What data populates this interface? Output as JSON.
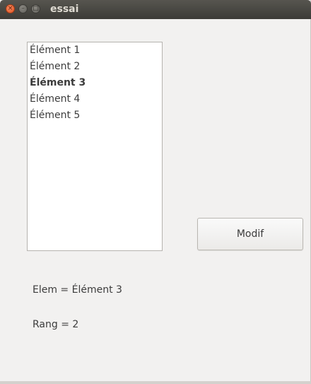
{
  "window": {
    "title": "essai",
    "close_glyph": "×",
    "min_glyph": "–",
    "max_glyph": "□"
  },
  "list": {
    "selected_index": 2,
    "items": [
      {
        "label": "Élément 1"
      },
      {
        "label": "Élément 2"
      },
      {
        "label": "Élément 3"
      },
      {
        "label": "Élément 4"
      },
      {
        "label": "Élément 5"
      }
    ]
  },
  "button": {
    "label": "Modif"
  },
  "info": {
    "elem_text": "Elem = Élément 3",
    "rang_text": "Rang = 2"
  }
}
